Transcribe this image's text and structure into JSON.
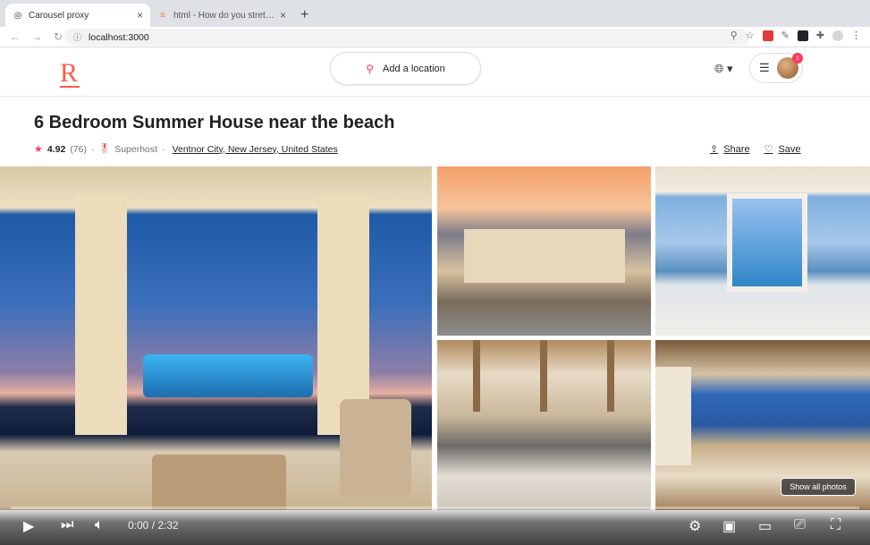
{
  "browser": {
    "tabs": [
      {
        "title": "Carousel proxy",
        "active": true
      },
      {
        "title": "html - How do you stretch an i",
        "active": false
      }
    ],
    "url": "localhost:3000",
    "new_tab": "+"
  },
  "header": {
    "logo": "R",
    "search_placeholder": "Add a location",
    "notifications": "1",
    "accent_color": "#ff385c"
  },
  "listing": {
    "title": "6 Bedroom Summer House near the beach",
    "rating": "4.92",
    "reviews": "(76)",
    "superhost": "Superhost",
    "location": "Ventnor City, New Jersey, United States",
    "share": "Share",
    "save": "Save"
  },
  "gallery": {
    "show_all": "Show all photos"
  },
  "player": {
    "time": "0:00 / 2:32"
  }
}
